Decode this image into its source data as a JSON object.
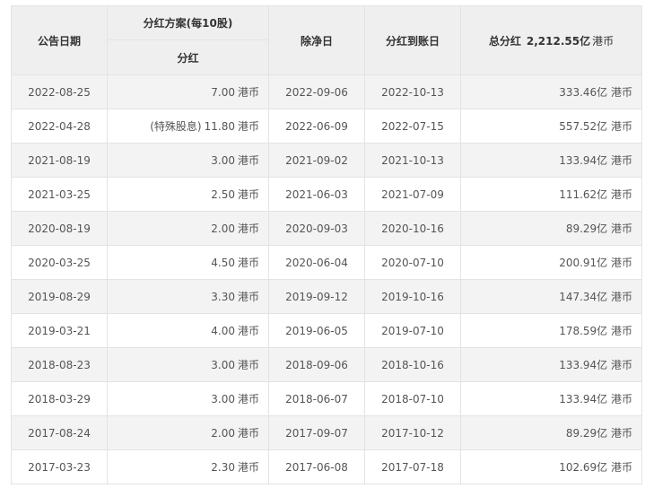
{
  "table": {
    "headers": {
      "announce_date": "公告日期",
      "plan_group": "分红方案(每10股)",
      "dividend": "分红",
      "ex_date": "除净日",
      "pay_date": "分红到账日",
      "total_label": "总分红",
      "total_amount": "2,212.55亿",
      "total_unit": "港币"
    },
    "rows": [
      {
        "announce": "2022-08-25",
        "prefix": "",
        "dividend": "7.00",
        "unit": "港币",
        "ex": "2022-09-06",
        "pay": "2022-10-13",
        "total": "333.46亿 港币"
      },
      {
        "announce": "2022-04-28",
        "prefix": "(特殊股息)",
        "dividend": "11.80",
        "unit": "港币",
        "ex": "2022-06-09",
        "pay": "2022-07-15",
        "total": "557.52亿 港币"
      },
      {
        "announce": "2021-08-19",
        "prefix": "",
        "dividend": "3.00",
        "unit": "港币",
        "ex": "2021-09-02",
        "pay": "2021-10-13",
        "total": "133.94亿 港币"
      },
      {
        "announce": "2021-03-25",
        "prefix": "",
        "dividend": "2.50",
        "unit": "港币",
        "ex": "2021-06-03",
        "pay": "2021-07-09",
        "total": "111.62亿 港币"
      },
      {
        "announce": "2020-08-19",
        "prefix": "",
        "dividend": "2.00",
        "unit": "港币",
        "ex": "2020-09-03",
        "pay": "2020-10-16",
        "total": "89.29亿 港币"
      },
      {
        "announce": "2020-03-25",
        "prefix": "",
        "dividend": "4.50",
        "unit": "港币",
        "ex": "2020-06-04",
        "pay": "2020-07-10",
        "total": "200.91亿 港币"
      },
      {
        "announce": "2019-08-29",
        "prefix": "",
        "dividend": "3.30",
        "unit": "港币",
        "ex": "2019-09-12",
        "pay": "2019-10-16",
        "total": "147.34亿 港币"
      },
      {
        "announce": "2019-03-21",
        "prefix": "",
        "dividend": "4.00",
        "unit": "港币",
        "ex": "2019-06-05",
        "pay": "2019-07-10",
        "total": "178.59亿 港币"
      },
      {
        "announce": "2018-08-23",
        "prefix": "",
        "dividend": "3.00",
        "unit": "港币",
        "ex": "2018-09-06",
        "pay": "2018-10-16",
        "total": "133.94亿 港币"
      },
      {
        "announce": "2018-03-29",
        "prefix": "",
        "dividend": "3.00",
        "unit": "港币",
        "ex": "2018-06-07",
        "pay": "2018-07-10",
        "total": "133.94亿 港币"
      },
      {
        "announce": "2017-08-24",
        "prefix": "",
        "dividend": "2.00",
        "unit": "港币",
        "ex": "2017-09-07",
        "pay": "2017-10-12",
        "total": "89.29亿 港币"
      },
      {
        "announce": "2017-03-23",
        "prefix": "",
        "dividend": "2.30",
        "unit": "港币",
        "ex": "2017-06-08",
        "pay": "2017-07-18",
        "total": "102.69亿 港币"
      }
    ]
  },
  "colors": {
    "header_bg": "#efefef",
    "row_alt_bg": "#f3f3f3",
    "border": "#e3e3e3",
    "text": "#555555"
  }
}
